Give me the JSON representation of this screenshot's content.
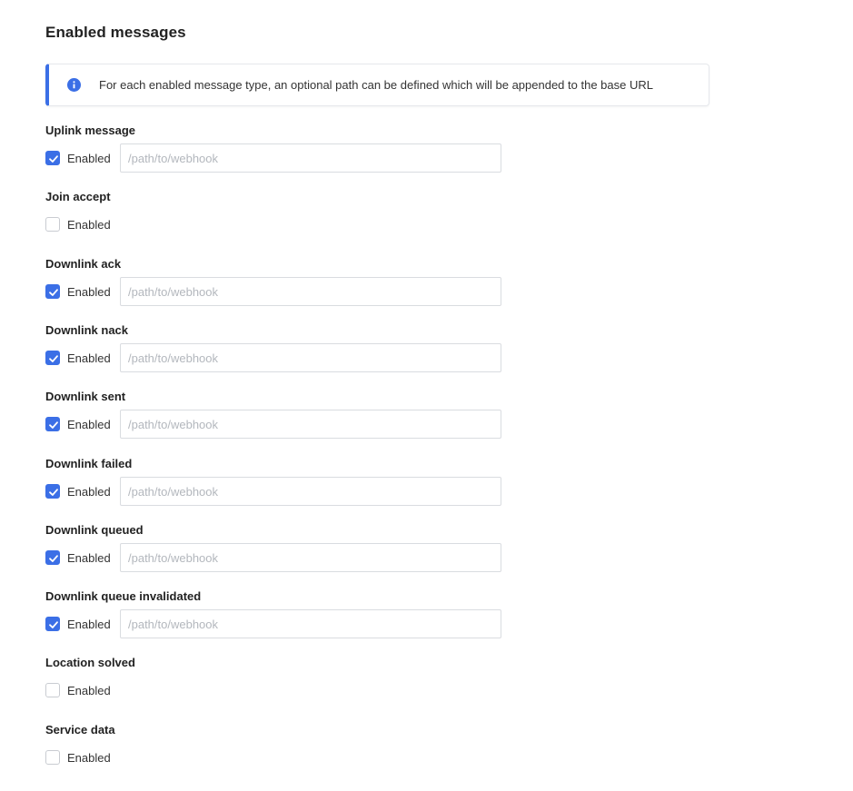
{
  "section": {
    "title": "Enabled messages"
  },
  "notice": {
    "icon": "info-icon",
    "text": "For each enabled message type, an optional path can be defined which will be appended to the base URL"
  },
  "colors": {
    "accent": "#3b6fe6"
  },
  "messages": [
    {
      "key": "uplink-message",
      "label": "Uplink message",
      "enabled": true,
      "checkbox_label": "Enabled",
      "path_placeholder": "/path/to/webhook",
      "path_value": ""
    },
    {
      "key": "join-accept",
      "label": "Join accept",
      "enabled": false,
      "checkbox_label": "Enabled"
    },
    {
      "key": "downlink-ack",
      "label": "Downlink ack",
      "enabled": true,
      "checkbox_label": "Enabled",
      "path_placeholder": "/path/to/webhook",
      "path_value": ""
    },
    {
      "key": "downlink-nack",
      "label": "Downlink nack",
      "enabled": true,
      "checkbox_label": "Enabled",
      "path_placeholder": "/path/to/webhook",
      "path_value": ""
    },
    {
      "key": "downlink-sent",
      "label": "Downlink sent",
      "enabled": true,
      "checkbox_label": "Enabled",
      "path_placeholder": "/path/to/webhook",
      "path_value": ""
    },
    {
      "key": "downlink-failed",
      "label": "Downlink failed",
      "enabled": true,
      "checkbox_label": "Enabled",
      "path_placeholder": "/path/to/webhook",
      "path_value": ""
    },
    {
      "key": "downlink-queued",
      "label": "Downlink queued",
      "enabled": true,
      "checkbox_label": "Enabled",
      "path_placeholder": "/path/to/webhook",
      "path_value": ""
    },
    {
      "key": "downlink-queue-invalidated",
      "label": "Downlink queue invalidated",
      "enabled": true,
      "checkbox_label": "Enabled",
      "path_placeholder": "/path/to/webhook",
      "path_value": ""
    },
    {
      "key": "location-solved",
      "label": "Location solved",
      "enabled": false,
      "checkbox_label": "Enabled"
    },
    {
      "key": "service-data",
      "label": "Service data",
      "enabled": false,
      "checkbox_label": "Enabled"
    }
  ]
}
